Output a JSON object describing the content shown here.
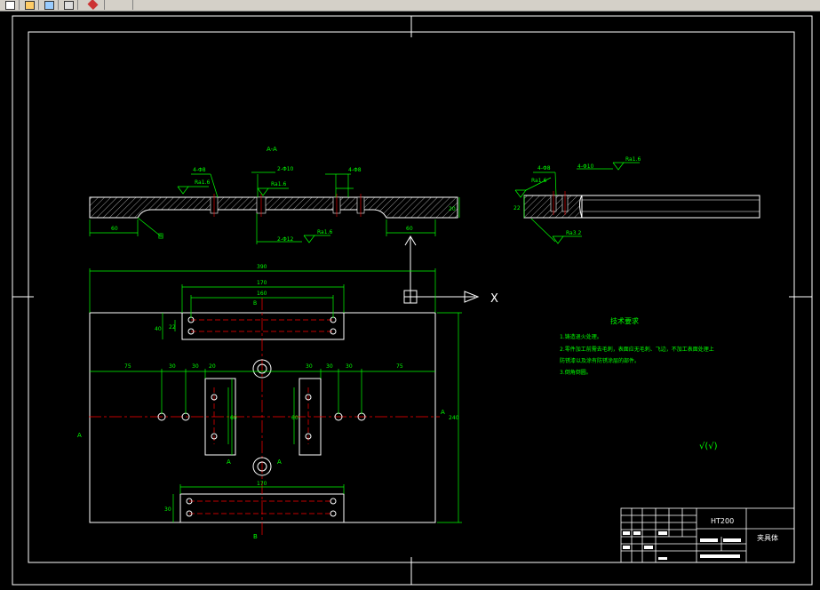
{
  "toolbar": {
    "buttons": [
      "new-icon",
      "open-icon",
      "save-icon",
      "print-icon",
      "draw-icon"
    ]
  },
  "colors": {
    "background": "#000000",
    "frame": "#ffffff",
    "outline": "#ffffff",
    "dimension": "#00ff00",
    "centerline": "#ff0000",
    "hatch": "#ffffff",
    "text": "#00ff00",
    "title_text": "#ffffff"
  },
  "drawing": {
    "section_label": "A-A",
    "section_marker_a": "A",
    "section_marker_b": "B",
    "top_dims": {
      "left_flat": "60",
      "right_flat": "60",
      "thickness": "20",
      "hole_left": "4-Φ8",
      "hole_mid": "2-Φ10",
      "hole_right": "4-Φ8",
      "hole_bottom": "2-Φ12",
      "rough_1": "Ra1.6",
      "rough_2": "Ra1.6",
      "rough_3": "Ra1.6",
      "chamfer_note": "圆"
    },
    "side_dims": {
      "hole_a": "4-Φ8",
      "hole_b": "4-Φ10",
      "rough_a": "Ra1.6",
      "rough_b": "Ra1.6",
      "rough_c": "Ra3.2",
      "thickness": "22"
    },
    "plan_dims": {
      "overall_width": "390",
      "top_slot_outer": "170",
      "top_slot_inner": "160",
      "top_slot_height": "22",
      "top_slot_depth": "40",
      "bottom_slot_width": "170",
      "bottom_slot_height": "30",
      "left_75": "75",
      "left_30": "30",
      "left_30b": "30",
      "right_30": "30",
      "right_30b": "30",
      "right_30c": "30",
      "right_75": "75",
      "left_slot_height": "60",
      "left_slot_w": "20",
      "right_slot_height": "60",
      "overall_height": "240",
      "slot_mark": "B"
    },
    "axis_label": "X"
  },
  "notes": {
    "heading": "技术要求",
    "lines": [
      "1.铸造退火处理。",
      "2.零件加工前需去毛刺，表面应无毛刺、飞边，不加工表面处理上",
      "防锈漆以及涂有防锈涂层的部件。",
      "3.倒角倒圆。"
    ]
  },
  "roughness_general": "√(√)",
  "title_block": {
    "material": "HT200",
    "part_name": "夹具体"
  }
}
